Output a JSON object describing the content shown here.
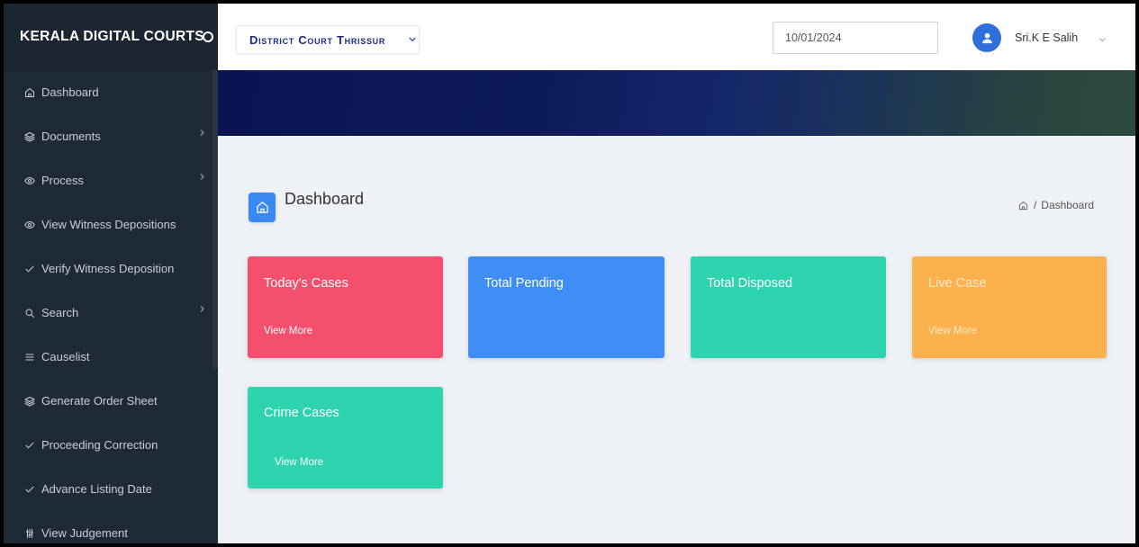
{
  "app": {
    "title": "KERALA DIGITAL COURTS",
    "toggle_icon": "sidebar-toggle-icon"
  },
  "sidebar": {
    "items": [
      {
        "label": "Dashboard",
        "icon": "home-icon",
        "has_submenu": false
      },
      {
        "label": "Documents",
        "icon": "layers-icon",
        "has_submenu": true
      },
      {
        "label": "Process",
        "icon": "eye-icon",
        "has_submenu": true
      },
      {
        "label": "View Witness Depositions",
        "icon": "eye-icon",
        "has_submenu": false
      },
      {
        "label": "Verify Witness Deposition",
        "icon": "check-icon",
        "has_submenu": false
      },
      {
        "label": "Search",
        "icon": "search-icon",
        "has_submenu": true
      },
      {
        "label": "Causelist",
        "icon": "list-icon",
        "has_submenu": false
      },
      {
        "label": "Generate Order Sheet",
        "icon": "layers-icon",
        "has_submenu": false
      },
      {
        "label": "Proceeding Correction",
        "icon": "check-icon",
        "has_submenu": false
      },
      {
        "label": "Advance Listing Date",
        "icon": "check-icon",
        "has_submenu": false
      },
      {
        "label": "View Judgement",
        "icon": "sliders-icon",
        "has_submenu": false
      }
    ]
  },
  "header": {
    "court_select": {
      "selected": "District Court Thrissur",
      "icon": "chevron-down-icon"
    },
    "date_input": {
      "value": "10/01/2024"
    },
    "user": {
      "name": "Sri.K E Salih",
      "avatar_icon": "user-icon",
      "menu_icon": "chevron-down-icon"
    }
  },
  "page": {
    "title": "Dashboard",
    "title_icon": "home-icon",
    "breadcrumb": {
      "home_icon": "home-icon",
      "separator": "/",
      "current": "Dashboard"
    }
  },
  "cards": [
    {
      "title": "Today's Cases",
      "link": "View More",
      "color": "#f4506d"
    },
    {
      "title": "Total Pending",
      "color": "#3f8ef6"
    },
    {
      "title": "Total Disposed",
      "color": "#2ed3b0"
    },
    {
      "title": "Live Case",
      "link": "View More",
      "color": "#fbb14c"
    },
    {
      "title": "Crime Cases",
      "link": "View More",
      "color": "#2ed3b0"
    }
  ],
  "theme": {
    "sidebar_bg": "#1f2a37",
    "content_bg": "#eef1f5",
    "accent": "#3a89f3",
    "avatar_bg": "#2e6fd9",
    "banner_start": "#0a1452",
    "banner_end": "#2e4b3e"
  }
}
